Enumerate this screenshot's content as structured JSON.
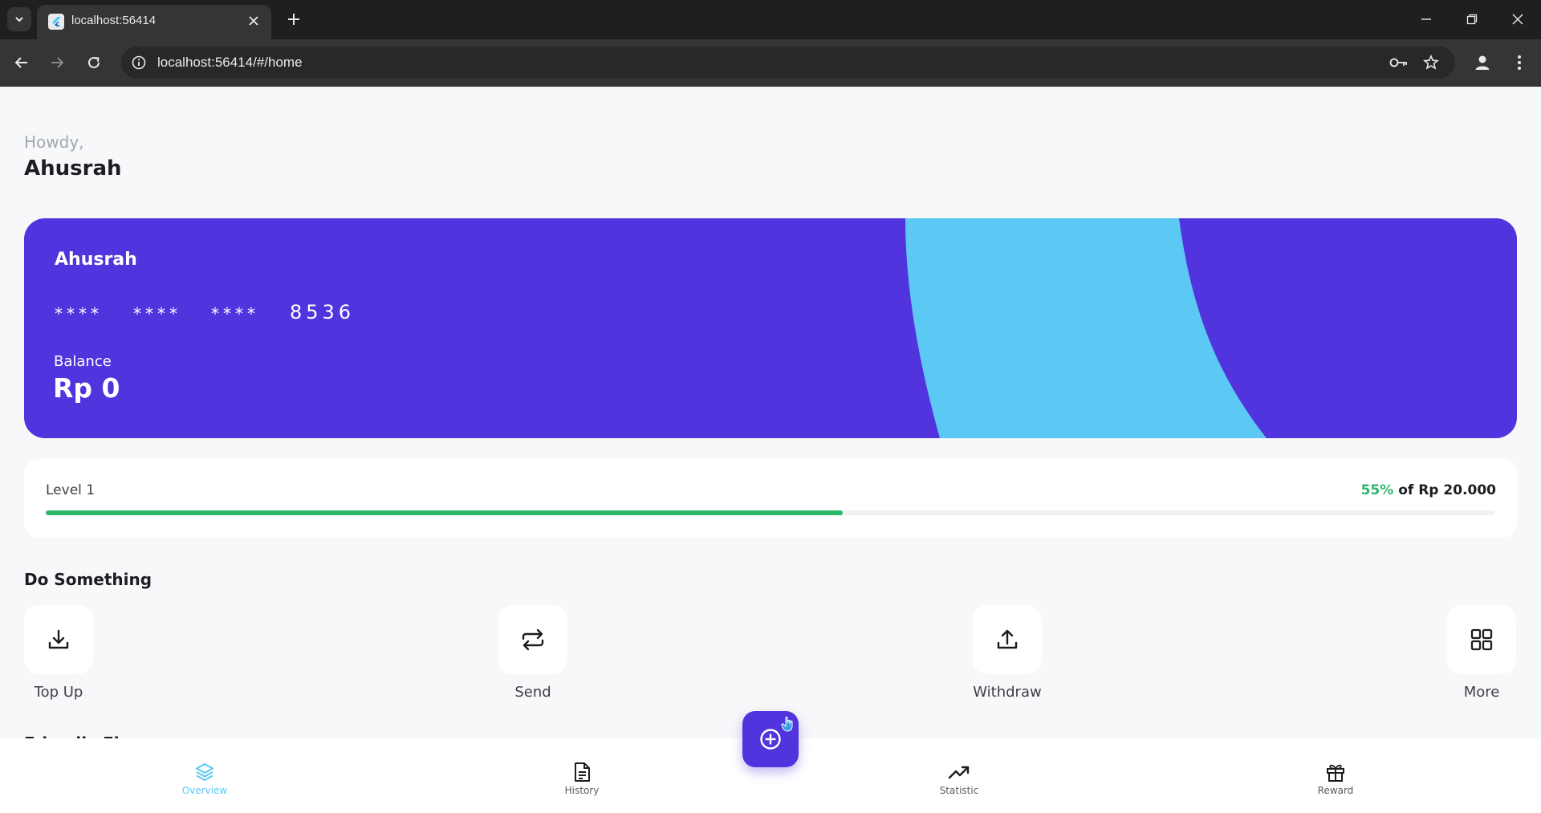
{
  "browser": {
    "tab_title": "localhost:56414",
    "url": "localhost:56414/#/home"
  },
  "greeting": "Howdy,",
  "user_name": "Ahusrah",
  "card": {
    "holder": "Ahusrah",
    "number_groups": [
      "****",
      "****",
      "****",
      "8536"
    ],
    "balance_label": "Balance",
    "balance": "Rp 0",
    "colors": {
      "background": "#5134de",
      "accent": "#5cc8f4"
    }
  },
  "level": {
    "label": "Level 1",
    "percent_text": "55%",
    "of_text": " of Rp 20.000",
    "progress": 0.55
  },
  "actions": {
    "title": "Do Something",
    "items": [
      {
        "label": "Top Up",
        "icon": "download-icon"
      },
      {
        "label": "Send",
        "icon": "transfer-icon"
      },
      {
        "label": "Withdraw",
        "icon": "upload-icon"
      },
      {
        "label": "More",
        "icon": "grid-icon"
      }
    ]
  },
  "next_section_peek": "Friendly Fin",
  "bottom_nav": {
    "items": [
      {
        "label": "Overview",
        "icon": "layers-icon",
        "active": true
      },
      {
        "label": "History",
        "icon": "document-icon",
        "active": false
      },
      {
        "label": "Statistic",
        "icon": "trending-up-icon",
        "active": false
      },
      {
        "label": "Reward",
        "icon": "gift-icon",
        "active": false
      }
    ],
    "fab_icon": "plus-circle-icon"
  }
}
